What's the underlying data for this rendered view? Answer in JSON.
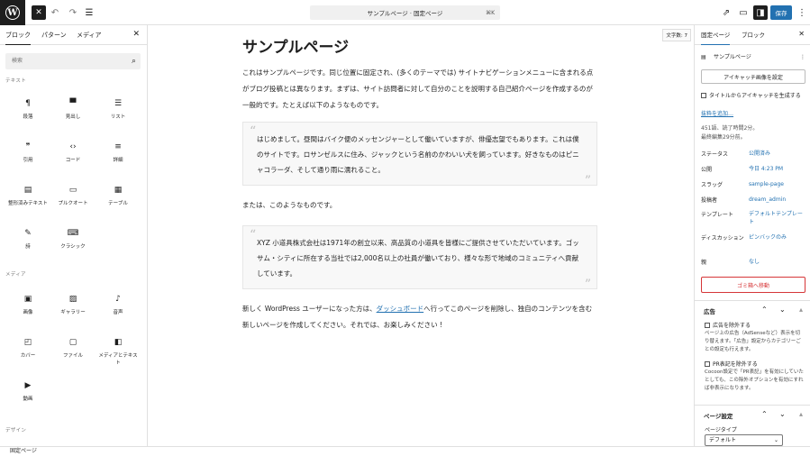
{
  "topbar": {
    "logo_glyph": "W",
    "doc_title": "サンプルページ · 固定ページ",
    "shortcut": "⌘K",
    "save_label": "保存"
  },
  "left": {
    "tabs": [
      "ブロック",
      "パターン",
      "メディア"
    ],
    "search_placeholder": "検索",
    "categories": {
      "text": "テキスト",
      "media": "メディア",
      "design": "デザイン"
    },
    "text_blocks": [
      {
        "label": "段落",
        "icon": "¶",
        "icon_name": "paragraph-icon"
      },
      {
        "label": "見出し",
        "icon": "▀",
        "icon_name": "heading-icon"
      },
      {
        "label": "リスト",
        "icon": "☰",
        "icon_name": "list-icon"
      },
      {
        "label": "引用",
        "icon": "❞",
        "icon_name": "quote-icon"
      },
      {
        "label": "コード",
        "icon": "‹›",
        "icon_name": "code-icon"
      },
      {
        "label": "詳細",
        "icon": "≡",
        "icon_name": "details-icon"
      },
      {
        "label": "整形済みテキスト",
        "icon": "▤",
        "icon_name": "preformatted-icon"
      },
      {
        "label": "プルクオート",
        "icon": "▭",
        "icon_name": "pullquote-icon"
      },
      {
        "label": "テーブル",
        "icon": "▦",
        "icon_name": "table-icon"
      },
      {
        "label": "詩",
        "icon": "✎",
        "icon_name": "verse-icon"
      },
      {
        "label": "クラシック",
        "icon": "⌨",
        "icon_name": "classic-icon"
      }
    ],
    "media_blocks": [
      {
        "label": "画像",
        "icon": "▣",
        "icon_name": "image-icon"
      },
      {
        "label": "ギャラリー",
        "icon": "▨",
        "icon_name": "gallery-icon"
      },
      {
        "label": "音声",
        "icon": "♪",
        "icon_name": "audio-icon"
      },
      {
        "label": "カバー",
        "icon": "◰",
        "icon_name": "cover-icon"
      },
      {
        "label": "ファイル",
        "icon": "▢",
        "icon_name": "file-icon"
      },
      {
        "label": "メディアとテキスト",
        "icon": "◧",
        "icon_name": "media-text-icon"
      },
      {
        "label": "動画",
        "icon": "▶",
        "icon_name": "video-icon"
      }
    ]
  },
  "canvas": {
    "word_count": "文字数: 7",
    "title": "サンプルページ",
    "para1": "これはサンプルページです。同じ位置に固定され、(多くのテーマでは) サイトナビゲーションメニューに含まれる点がブログ投稿とは異なります。まずは、サイト訪問者に対して自分のことを説明する自己紹介ページを作成するのが一般的です。たとえば以下のようなものです。",
    "quote1": "はじめまして。昼間はバイク便のメッセンジャーとして働いていますが、俳優志望でもあります。これは僕のサイトです。ロサンゼルスに住み、ジャックという名前のかわいい犬を飼っています。好きなものはピニャコラーダ、そして通り雨に濡れること。",
    "para2": "または、このようなものです。",
    "quote2": "XYZ 小道具株式会社は1971年の創立以来、高品質の小道具を皆様にご提供させていただいています。ゴッサム・シティに所在する当社では2,000名以上の社員が働いており、様々な形で地域のコミュニティへ貢献しています。",
    "para3_before": "新しく WordPress ユーザーになった方は、",
    "para3_link": "ダッシュボード",
    "para3_after": "へ行ってこのページを削除し、独自のコンテンツを含む新しいページを作成してください。それでは、お楽しみください !"
  },
  "right": {
    "tabs": [
      "固定ページ",
      "ブロック"
    ],
    "page_name": "サンプルページ",
    "featured_button": "アイキャッチ画像を設定",
    "featured_checkbox": "タイトルからアイキャッチを生成する",
    "add_excerpt": "抜粋を追加…",
    "meta_line1": "451語、読了時間2分。",
    "meta_line2": "最終編集29分前。",
    "fields": [
      {
        "label": "ステータス",
        "value": "公開済み"
      },
      {
        "label": "公開",
        "value": "今日 4:23 PM"
      },
      {
        "label": "スラッグ",
        "value": "sample-page"
      },
      {
        "label": "投稿者",
        "value": "dream_admin"
      },
      {
        "label": "テンプレート",
        "value": "デフォルトテンプレート"
      },
      {
        "label": "ディスカッション",
        "value": "ピンバックのみ"
      },
      {
        "label": "親",
        "value": "なし"
      }
    ],
    "trash_button": "ゴミ箱へ移動",
    "ads_panel": {
      "title": "広告",
      "cb1_label": "広告を除外する",
      "cb1_desc": "ページ上の広告（AdSenseなど）表示を切り替えます。「広告」設定からカテゴリーごとの設定も行えます。",
      "cb2_label": "PR表記を除外する",
      "cb2_desc": "Cocoon設定で「PR表記」を有効にしていたとしても、この除外オプションを有効にすれば非表示になります。"
    },
    "page_settings": {
      "title": "ページ設定",
      "type_label": "ページタイプ",
      "type_value": "デフォルト"
    }
  },
  "status_bar": "固定ページ",
  "colors": {
    "accent": "#2271b1",
    "danger": "#d63638",
    "dark": "#1e1e1e"
  }
}
